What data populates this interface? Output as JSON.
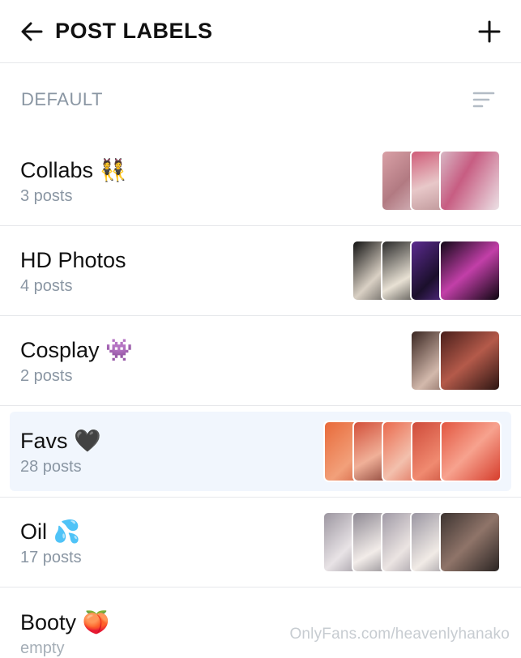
{
  "header": {
    "title": "POST LABELS"
  },
  "section": {
    "label": "DEFAULT"
  },
  "labels": [
    {
      "name": "Collabs 👯",
      "count": "3 posts"
    },
    {
      "name": "HD Photos",
      "count": "4 posts"
    },
    {
      "name": "Cosplay 👾",
      "count": "2 posts"
    },
    {
      "name": "Favs 🖤",
      "count": "28 posts"
    },
    {
      "name": "Oil 💦",
      "count": "17 posts"
    },
    {
      "name": "Booty 🍑",
      "count": "empty"
    }
  ],
  "watermark": "OnlyFans.com/heavenlyhanako",
  "colors": {
    "accent": "#00aff0",
    "muted": "#8a96a3",
    "selected_bg": "#f1f6fd"
  }
}
